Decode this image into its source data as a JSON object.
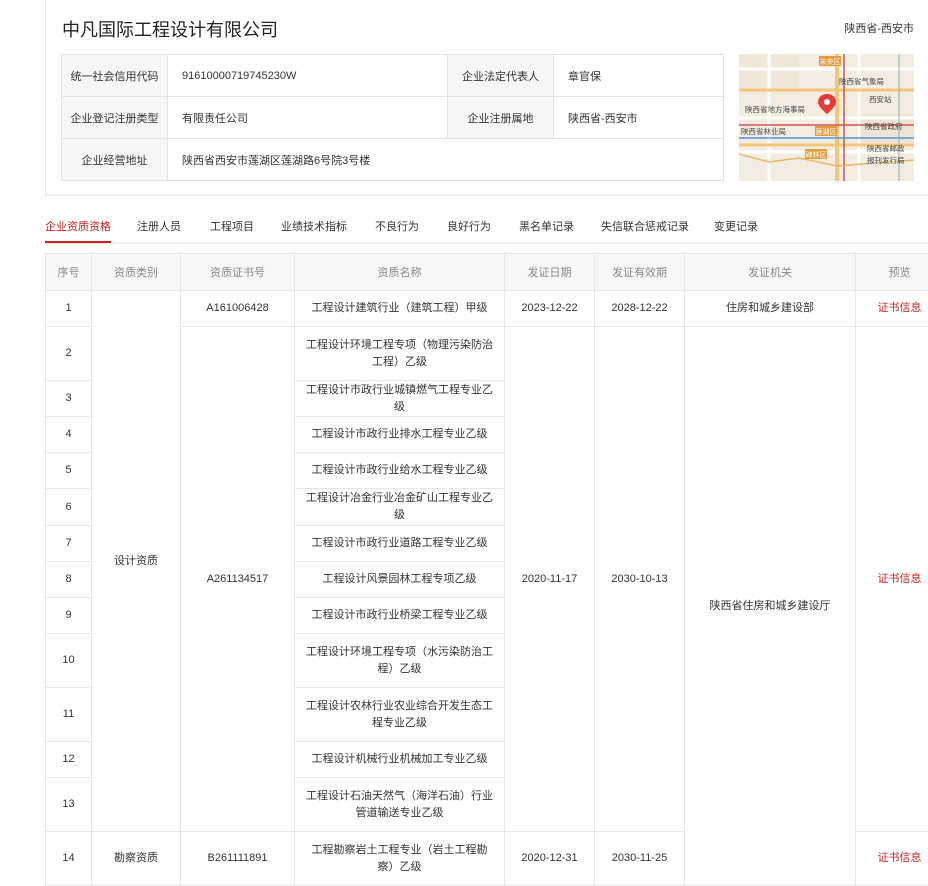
{
  "company": {
    "name": "中凡国际工程设计有限公司",
    "location": "陕西省-西安市"
  },
  "info": {
    "credit_code_label": "统一社会信用代码",
    "credit_code": "91610000719745230W",
    "legal_rep_label": "企业法定代表人",
    "legal_rep": "章官保",
    "reg_type_label": "企业登记注册类型",
    "reg_type": "有限责任公司",
    "reg_place_label": "企业注册属地",
    "reg_place": "陕西省-西安市",
    "address_label": "企业经营地址",
    "address": "陕西省西安市莲湖区莲湖路6号院3号楼"
  },
  "map": {
    "labels": [
      "未央区",
      "陕西省气象局",
      "陕西省地方海事局",
      "西安站",
      "陕西省林业局",
      "莲湖区",
      "陕西省政府",
      "碑林区",
      "陕西省邮政",
      "报刊发行局"
    ]
  },
  "tabs": [
    "企业资质资格",
    "注册人员",
    "工程项目",
    "业绩技术指标",
    "不良行为",
    "良好行为",
    "黑名单记录",
    "失信联合惩戒记录",
    "变更记录"
  ],
  "table": {
    "headers": [
      "序号",
      "资质类别",
      "资质证书号",
      "资质名称",
      "发证日期",
      "发证有效期",
      "发证机关",
      "预览"
    ],
    "design_category": "设计资质",
    "survey_category": "勘察资质",
    "cert_link": "证书信息",
    "row1": {
      "no": "1",
      "cert": "A161006428",
      "name": "工程设计建筑行业（建筑工程）甲级",
      "issue": "2023-12-22",
      "expire": "2028-12-22",
      "authority": "住房和城乡建设部"
    },
    "group2": {
      "cert": "A261134517",
      "issue": "2020-11-17",
      "expire": "2030-10-13",
      "authority": "陕西省住房和城乡建设厅"
    },
    "group2_rows": [
      {
        "no": "2",
        "name": "工程设计环境工程专项（物理污染防治工程）乙级"
      },
      {
        "no": "3",
        "name": "工程设计市政行业城镇燃气工程专业乙级"
      },
      {
        "no": "4",
        "name": "工程设计市政行业排水工程专业乙级"
      },
      {
        "no": "5",
        "name": "工程设计市政行业给水工程专业乙级"
      },
      {
        "no": "6",
        "name": "工程设计冶金行业冶金矿山工程专业乙级"
      },
      {
        "no": "7",
        "name": "工程设计市政行业道路工程专业乙级"
      },
      {
        "no": "8",
        "name": "工程设计风景园林工程专项乙级"
      },
      {
        "no": "9",
        "name": "工程设计市政行业桥梁工程专业乙级"
      },
      {
        "no": "10",
        "name": "工程设计环境工程专项（水污染防治工程）乙级"
      },
      {
        "no": "11",
        "name": "工程设计农林行业农业综合开发生态工程专业乙级"
      },
      {
        "no": "12",
        "name": "工程设计机械行业机械加工专业乙级"
      },
      {
        "no": "13",
        "name": "工程设计石油天然气（海洋石油）行业管道输送专业乙级"
      }
    ],
    "row14": {
      "no": "14",
      "cert": "B261111891",
      "name": "工程勘察岩土工程专业（岩土工程勘察）乙级",
      "issue": "2020-12-31",
      "expire": "2030-11-25"
    }
  }
}
